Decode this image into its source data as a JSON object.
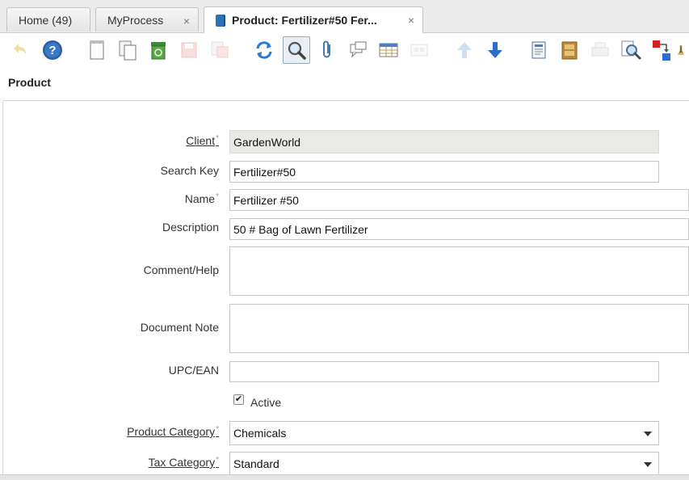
{
  "tabs": [
    {
      "label": "Home (49)"
    },
    {
      "label": "MyProcess",
      "close": "×"
    },
    {
      "label": "Product: Fertilizer#50 Fer...",
      "close": "×"
    }
  ],
  "toolbar": {
    "icons": [
      "undo-icon",
      "help-icon",
      "new-record-icon",
      "copy-record-icon",
      "delete-icon",
      "save-icon",
      "save-new-icon",
      "refresh-icon",
      "find-icon",
      "attachment-icon",
      "chat-icon",
      "grid-toggle-icon",
      "parent-icon",
      "previous-record-icon",
      "next-record-icon",
      "report-icon",
      "archive-icon",
      "print-icon",
      "zoom-across-icon",
      "workflow-icon",
      "process-icon"
    ]
  },
  "window": {
    "title": "Product"
  },
  "form": {
    "client": {
      "label": "Client",
      "value": "GardenWorld"
    },
    "search_key": {
      "label": "Search Key",
      "value": "Fertilizer#50"
    },
    "name": {
      "label": "Name",
      "value": "Fertilizer #50"
    },
    "description": {
      "label": "Description",
      "value": "50 # Bag of Lawn Fertilizer"
    },
    "comment_help": {
      "label": "Comment/Help",
      "value": ""
    },
    "document_note": {
      "label": "Document Note",
      "value": ""
    },
    "upc_ean": {
      "label": "UPC/EAN",
      "value": ""
    },
    "active": {
      "label": "Active",
      "checked": true,
      "mark": "✔"
    },
    "product_category": {
      "label": "Product Category",
      "value": "Chemicals"
    },
    "tax_category": {
      "label": "Tax Category",
      "value": "Standard"
    },
    "required_mark": "*"
  },
  "colors": {
    "accent": "#2f6fb3",
    "readonly_bg": "#e9e9e6"
  }
}
